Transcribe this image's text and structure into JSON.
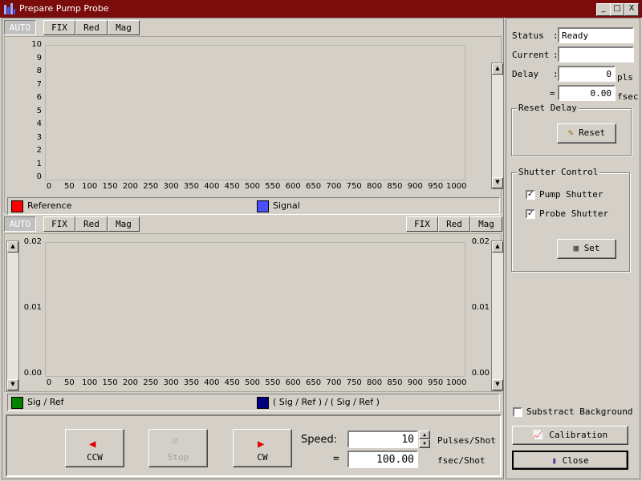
{
  "window": {
    "title": "Prepare Pump Probe",
    "minimize": "_",
    "maximize": "□",
    "close": "X"
  },
  "top_plot": {
    "tabs": [
      "AUTO",
      "FIX",
      "Red",
      "Mag"
    ],
    "y_ticks": [
      "10",
      "9",
      "8",
      "7",
      "6",
      "5",
      "4",
      "3",
      "2",
      "1",
      "0"
    ],
    "x_ticks": [
      "0",
      "50",
      "100",
      "150",
      "200",
      "250",
      "300",
      "350",
      "400",
      "450",
      "500",
      "550",
      "600",
      "650",
      "700",
      "750",
      "800",
      "850",
      "900",
      "950",
      "1000"
    ],
    "legend": [
      {
        "label": "Reference",
        "color": "#ff0000"
      },
      {
        "label": "Signal",
        "color": "#4a50ff"
      }
    ]
  },
  "bottom_plot": {
    "tabs_left": [
      "AUTO",
      "FIX",
      "Red",
      "Mag"
    ],
    "tabs_right": [
      "FIX",
      "Red",
      "Mag"
    ],
    "y_ticks": [
      "0.02",
      "0.01",
      "0.00"
    ],
    "x_ticks": [
      "0",
      "50",
      "100",
      "150",
      "200",
      "250",
      "300",
      "350",
      "400",
      "450",
      "500",
      "550",
      "600",
      "650",
      "700",
      "750",
      "800",
      "850",
      "900",
      "950",
      "1000"
    ],
    "legend": [
      {
        "label": "Sig / Ref",
        "color": "#008000"
      },
      {
        "label": "( Sig / Ref ) / ( Sig / Ref )",
        "color": "#00007f"
      }
    ]
  },
  "controls": {
    "ccw_label": "CCW",
    "stop_label": "Stop",
    "cw_label": "CW",
    "speed_label": "Speed:",
    "speed_value": "10",
    "speed_unit": "Pulses/Shot",
    "equals": "=",
    "fsec_value": "100.00",
    "fsec_unit": "fsec/Shot"
  },
  "side": {
    "status_label": "Status",
    "status_value": "Ready",
    "current_label": "Current",
    "current_value": "",
    "delay_label": "Delay",
    "colon": ":",
    "delay_pls": "0",
    "pls_unit": "pls",
    "delay_eq": "=",
    "delay_fsec": "0.00",
    "fsec_unit": "fsec",
    "reset_group": "Reset Delay",
    "reset_button": "Reset",
    "shutter_group": "Shutter Control",
    "pump_shutter": "Pump Shutter",
    "probe_shutter": "Probe Shutter",
    "set_button": "Set",
    "subtract_bg": "Substract Background",
    "calibration_button": "Calibration",
    "close_button": "Close",
    "pump_checked": "✓",
    "probe_checked": "✓"
  }
}
